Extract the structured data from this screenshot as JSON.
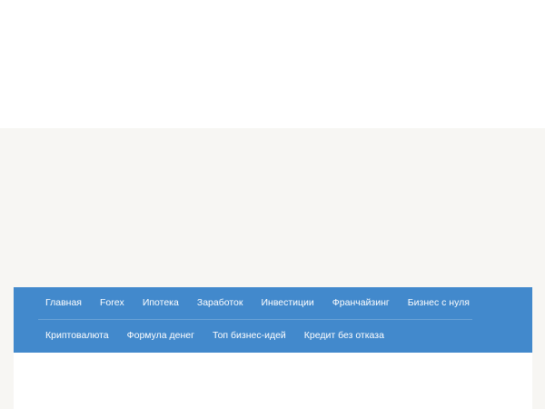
{
  "nav": {
    "row1": [
      "Главная",
      "Forex",
      "Ипотека",
      "Заработок",
      "Инвестиции",
      "Франчайзинг",
      "Бизнес с нуля"
    ],
    "row2": [
      "Криптовалюта",
      "Формула денег",
      "Топ бизнес-идей",
      "Кредит без отказа"
    ]
  },
  "colors": {
    "nav_background": "#4289cc",
    "page_background": "#f7f6f3",
    "nav_text": "#ffffff"
  }
}
